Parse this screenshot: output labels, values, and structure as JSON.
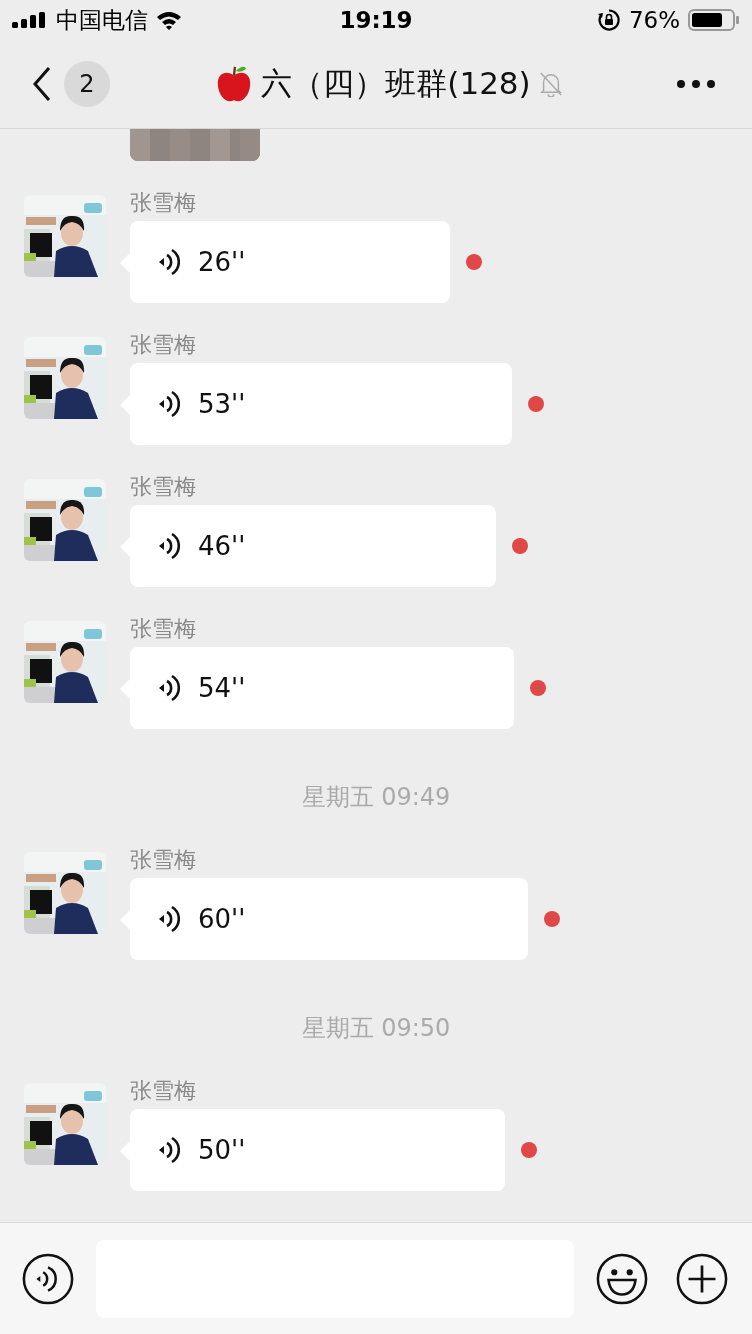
{
  "status_bar": {
    "carrier": "中国电信",
    "time": "19:19",
    "battery": "76%"
  },
  "header": {
    "back_badge": "2",
    "title": "六（四）班群(128)",
    "muted": true
  },
  "messages": [
    {
      "kind": "picture"
    },
    {
      "kind": "voice",
      "sender": "张雪梅",
      "duration": "26''",
      "unread": true
    },
    {
      "kind": "voice",
      "sender": "张雪梅",
      "duration": "53''",
      "unread": true
    },
    {
      "kind": "voice",
      "sender": "张雪梅",
      "duration": "46''",
      "unread": true
    },
    {
      "kind": "voice",
      "sender": "张雪梅",
      "duration": "54''",
      "unread": true
    },
    {
      "kind": "time",
      "text": "星期五 09:49"
    },
    {
      "kind": "voice",
      "sender": "张雪梅",
      "duration": "60''",
      "unread": true
    },
    {
      "kind": "time",
      "text": "星期五 09:50"
    },
    {
      "kind": "voice",
      "sender": "张雪梅",
      "duration": "50''",
      "unread": true
    }
  ]
}
